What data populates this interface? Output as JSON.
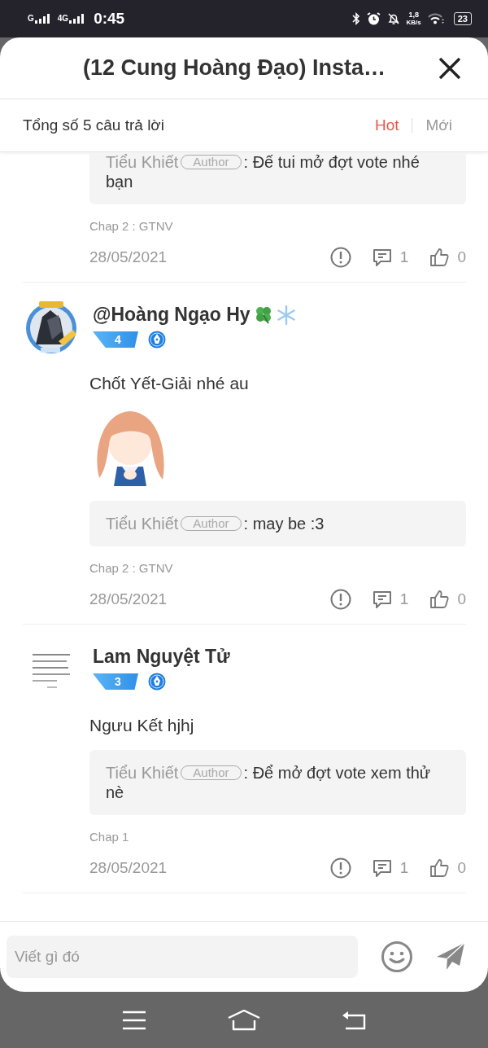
{
  "status_bar": {
    "network_1": "G",
    "network_2": "4G",
    "time": "0:45",
    "speed": "1,8",
    "speed_unit": "KB/s",
    "battery": "23"
  },
  "header": {
    "title": "(12 Cung Hoàng Đạo) Insta…"
  },
  "summary": "Tổng số 5 câu trả lời",
  "sort_tabs": [
    {
      "label": "Hot",
      "selected": true
    },
    {
      "label": "Mới",
      "selected": false
    }
  ],
  "comments": [
    {
      "reply": {
        "author": "Tiểu Khiết",
        "role": "Author",
        "text": ": Đế tui mở đợt vote nhé bạn"
      },
      "chapter": "Chap 2 : GTNV",
      "date": "28/05/2021",
      "replies": "1",
      "likes": "0"
    },
    {
      "author": "@Hoàng Ngạo Hy",
      "name_icons": [
        {
          "kind": "clover"
        },
        {
          "kind": "snowflake"
        }
      ],
      "level": "4",
      "text": "Chốt Yết-Giải nhé au",
      "reply": {
        "author": "Tiểu Khiết",
        "role": "Author",
        "text": ": may be :3"
      },
      "chapter": "Chap 2 : GTNV",
      "date": "28/05/2021",
      "replies": "1",
      "likes": "0"
    },
    {
      "author": "Lam Nguyệt Tử",
      "level": "3",
      "text": "Ngưu Kết hjhj",
      "reply": {
        "author": "Tiểu Khiết",
        "role": "Author",
        "text": ": Để mở đợt vote xem thử nè"
      },
      "chapter": "Chap 1",
      "date": "28/05/2021",
      "replies": "1",
      "likes": "0"
    }
  ],
  "composer": {
    "placeholder": "Viết gì đó"
  }
}
